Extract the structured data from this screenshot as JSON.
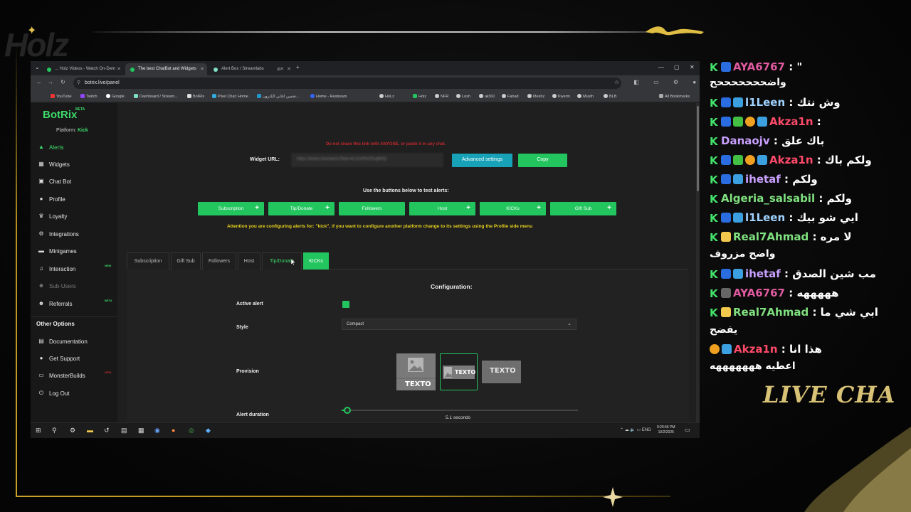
{
  "browser": {
    "tabs": [
      {
        "label": "... Holz Videos - Watch On-Dem",
        "color": "#22c55e"
      },
      {
        "label": "The best ChatBot and Widgets",
        "color": "#22c55e"
      },
      {
        "label": "Alert Box / Streamlabs",
        "color": "#80e0c0"
      }
    ],
    "url": "botrix.live/panel",
    "bookmarks": [
      "YouTube",
      "Twitch",
      "Google",
      "Dashboard / Stream...",
      "BotRix",
      "Pixel Chat: Home",
      "تخمين اغاني الكترون...",
      "Home - Restream",
      "HoLz",
      "Holz",
      "NFR",
      "Losh",
      "ak9Xl",
      "Fahad",
      "Meshz",
      "Kwerm",
      "Musth",
      "BLB",
      "All Bookmarks"
    ]
  },
  "sidebar": {
    "brand": "BotRix",
    "brand_badge": "BETA",
    "platform_label": "Platform:",
    "platform_value": "Kick",
    "items": [
      {
        "label": "Alerts",
        "icon": "alert-icon",
        "glyph": "▲"
      },
      {
        "label": "Widgets",
        "icon": "widgets-icon",
        "glyph": "▦"
      },
      {
        "label": "Chat Bot",
        "icon": "chat-bot-icon",
        "glyph": "▣"
      },
      {
        "label": "Profile",
        "icon": "profile-icon",
        "glyph": "●"
      },
      {
        "label": "Loyalty",
        "icon": "trophy-icon",
        "glyph": "♛"
      },
      {
        "label": "Integrations",
        "icon": "integrations-icon",
        "glyph": "⚙"
      },
      {
        "label": "Minigames",
        "icon": "gamepad-icon",
        "glyph": "▬"
      },
      {
        "label": "Interaction",
        "icon": "music-icon",
        "glyph": "♫",
        "badge": "NEW"
      },
      {
        "label": "Sub-Users",
        "icon": "sub-users-icon",
        "glyph": "👥"
      },
      {
        "label": "Referrals",
        "icon": "referrals-icon",
        "glyph": "👥",
        "badge": "BETA"
      }
    ],
    "other_title": "Other Options",
    "other_items": [
      {
        "label": "Documentation",
        "icon": "document-icon",
        "glyph": "▤"
      },
      {
        "label": "Get Support",
        "icon": "support-icon",
        "glyph": "●"
      },
      {
        "label": "MonsterBuilds",
        "icon": "monster-icon",
        "glyph": "▭",
        "badge": "NEW"
      },
      {
        "label": "Log Out",
        "icon": "logout-icon",
        "glyph": "⏻"
      }
    ]
  },
  "main": {
    "warning": "Do not share this link with ANYONE, or paste it in any chat.",
    "widget_url_label": "Widget URL:",
    "widget_url_value": "https://botrix.live/alerts?bid=4C11HPkdTcoj9HQ",
    "advanced_settings": "Advanced settings",
    "copy": "Copy",
    "test_label": "Use the buttons below to test alerts:",
    "test_buttons": [
      {
        "label": "Subscription",
        "plus": true
      },
      {
        "label": "Tip/Donate",
        "plus": true
      },
      {
        "label": "Followers",
        "plus": false
      },
      {
        "label": "Host",
        "plus": true
      },
      {
        "label": "KICKs",
        "plus": true
      },
      {
        "label": "Gift Sub",
        "plus": true
      }
    ],
    "attention": "Attention you are configuring alerts for: \"kick\", if you want to configure another platform change to its settings using the Profile side menu",
    "config_tabs": [
      "Subscription",
      "Gift Sub",
      "Followers",
      "Host",
      "Tip/Donate",
      "KICKs"
    ],
    "active_tab": "KICKs",
    "config_title": "Configuration:",
    "active_alert_label": "Active alert",
    "active_alert": true,
    "style_label": "Style",
    "style_value": "Compact",
    "provision_label": "Provision",
    "provision_text": "TEXTO",
    "provision_selected": 1,
    "duration_label": "Alert duration",
    "duration_value": "5.1 seconds"
  },
  "taskbar": {
    "time": "9:20:56 PM",
    "date": "10/2/2025",
    "lang": "ENG"
  },
  "chat": {
    "messages": [
      {
        "user": "AYA6767",
        "text": ": \"",
        "user_color": "#e05aa0"
      },
      {
        "user": "",
        "text": "واضحححححححح",
        "user_color": "#ffffff"
      },
      {
        "user": "l1Leen",
        "text": ": وش نتك",
        "user_color": "#9fd2ff"
      },
      {
        "user": "Akza1n",
        "text": ":",
        "user_color": "#ff4a6a"
      },
      {
        "user": "Danaojv",
        "text": ": باك علق",
        "user_color": "#c9a0ff"
      },
      {
        "user": "Akza1n",
        "text": ": ولكم باك",
        "user_color": "#ff4a6a"
      },
      {
        "user": "ihetaf",
        "text": ": ولكم",
        "user_color": "#c9a0ff"
      },
      {
        "user": "Algeria_salsabil",
        "text": ": ولكم",
        "user_color": "#7fe07f"
      },
      {
        "user": "l1Leen",
        "text": ": ايي شو بيك",
        "user_color": "#9fd2ff"
      },
      {
        "user": "Real7Ahmad",
        "text": ": لا مره",
        "user_color": "#7fe07f"
      },
      {
        "user": "",
        "text": "واضح مزروف",
        "user_color": "#ffffff"
      },
      {
        "user": "ihetaf",
        "text": ": مب شين الصدق",
        "user_color": "#c9a0ff"
      },
      {
        "user": "AYA6767",
        "text": ": هههههه",
        "user_color": "#e05aa0"
      },
      {
        "user": "Real7Ahmad",
        "text": ": ابي شي ما",
        "user_color": "#7fe07f"
      },
      {
        "user": "",
        "text": "يفضح",
        "user_color": "#ffffff"
      },
      {
        "user": "Akza1n",
        "text": ": هذا انا",
        "user_color": "#ff4a6a"
      },
      {
        "user": "",
        "text": "اعطيه هههههههه",
        "user_color": "#ffffff"
      }
    ],
    "live_chat_label": "LIVE CHA"
  },
  "overlay": {
    "logo": "Holz"
  },
  "colors": {
    "accent_green": "#22c55e",
    "brand_green": "#3ddc6a",
    "warning_red": "#c0282d",
    "attention_yellow": "#e8d21d",
    "info_blue": "#17a2b8",
    "gold": "#c9a227"
  }
}
